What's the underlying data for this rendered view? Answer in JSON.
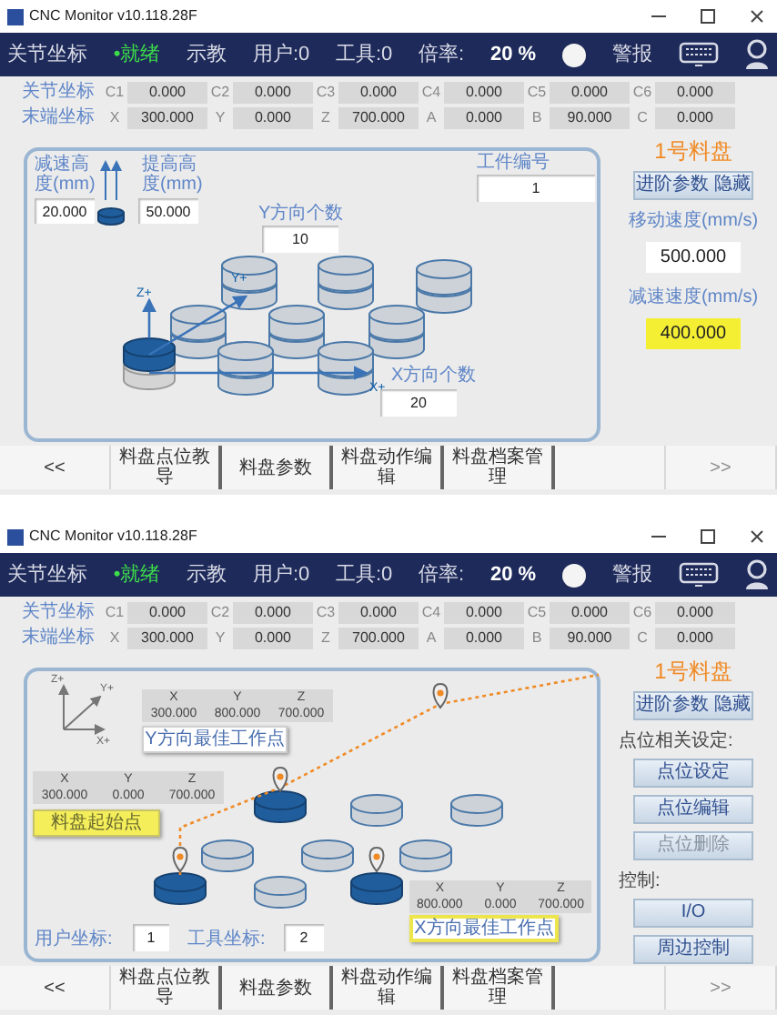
{
  "windows": [
    {
      "title_bar": {
        "title": "CNC Monitor v10.118.28F"
      },
      "status_bar": {
        "mode": "关节坐标",
        "state": {
          "text": "•就绪",
          "ok": true
        },
        "teach": "示教",
        "user": "用户:0",
        "tool": "工具:0",
        "rate_label": "倍率:",
        "rate": "20 %",
        "alarm": "警报"
      },
      "coordinates": [
        {
          "label": "关节坐标",
          "axes": [
            {
              "name": "C1",
              "value": "0.000"
            },
            {
              "name": "C2",
              "value": "0.000"
            },
            {
              "name": "C3",
              "value": "0.000"
            },
            {
              "name": "C4",
              "value": "0.000"
            },
            {
              "name": "C5",
              "value": "0.000"
            },
            {
              "name": "C6",
              "value": "0.000"
            }
          ]
        },
        {
          "label": "末端坐标",
          "axes": [
            {
              "name": "X",
              "value": "300.000"
            },
            {
              "name": "Y",
              "value": "0.000"
            },
            {
              "name": "Z",
              "value": "700.000"
            },
            {
              "name": "A",
              "value": "0.000"
            },
            {
              "name": "B",
              "value": "90.000"
            },
            {
              "name": "C",
              "value": "0.000"
            }
          ]
        }
      ],
      "panel": {
        "kind": "tray_params",
        "lower_height": {
          "label": "减速高度(mm)",
          "value": "20.000"
        },
        "lift_height": {
          "label": "提高高度(mm)",
          "value": "50.000"
        },
        "workpiece_no": {
          "label": "工件编号",
          "value": "1"
        },
        "y_count": {
          "label": "Y方向个数",
          "value": "10"
        },
        "x_count": {
          "label": "X方向个数",
          "value": "20"
        },
        "axis_labels": [
          "Z+",
          "Y+",
          "X+"
        ]
      },
      "side": [
        {
          "kind": "title",
          "text": "1号料盘"
        },
        {
          "kind": "button",
          "text": "进阶参数 隐藏",
          "disabled": false
        },
        {
          "kind": "label",
          "text": "移动速度(mm/s)"
        },
        {
          "kind": "field",
          "value": "500.000",
          "highlight": false
        },
        {
          "kind": "label",
          "text": "减速速度(mm/s)"
        },
        {
          "kind": "field",
          "value": "400.000",
          "highlight": true
        }
      ],
      "tabs": [
        {
          "label": "<<",
          "disabled": false
        },
        {
          "label": "料盘点位教导",
          "disabled": false
        },
        {
          "label": "料盘参数",
          "disabled": false
        },
        {
          "label": "料盘动作编辑",
          "disabled": false
        },
        {
          "label": "料盘档案管理",
          "disabled": false
        },
        {
          "label": ">>",
          "disabled": true
        }
      ]
    },
    {
      "title_bar": {
        "title": "CNC Monitor v10.118.28F"
      },
      "status_bar": {
        "mode": "关节坐标",
        "state": {
          "text": "•就绪",
          "ok": true
        },
        "teach": "示教",
        "user": "用户:0",
        "tool": "工具:0",
        "rate_label": "倍率:",
        "rate": "20 %",
        "alarm": "警报"
      },
      "coordinates": [
        {
          "label": "关节坐标",
          "axes": [
            {
              "name": "C1",
              "value": "0.000"
            },
            {
              "name": "C2",
              "value": "0.000"
            },
            {
              "name": "C3",
              "value": "0.000"
            },
            {
              "name": "C4",
              "value": "0.000"
            },
            {
              "name": "C5",
              "value": "0.000"
            },
            {
              "name": "C6",
              "value": "0.000"
            }
          ]
        },
        {
          "label": "末端坐标",
          "axes": [
            {
              "name": "X",
              "value": "300.000"
            },
            {
              "name": "Y",
              "value": "0.000"
            },
            {
              "name": "Z",
              "value": "700.000"
            },
            {
              "name": "A",
              "value": "0.000"
            },
            {
              "name": "B",
              "value": "90.000"
            },
            {
              "name": "C",
              "value": "0.000"
            }
          ]
        }
      ],
      "panel": {
        "kind": "point_teach",
        "axis_labels": [
          "Z+",
          "Y+",
          "X+"
        ],
        "points": [
          {
            "headers": [
              "X",
              "Y",
              "Z"
            ],
            "values": [
              "300.000",
              "800.000",
              "700.000"
            ],
            "button": "Y方向最佳工作点",
            "kind": "plain"
          },
          {
            "headers": [
              "X",
              "Y",
              "Z"
            ],
            "values": [
              "300.000",
              "0.000",
              "700.000"
            ],
            "button": "料盘起始点",
            "kind": "filled"
          },
          {
            "headers": [
              "X",
              "Y",
              "Z"
            ],
            "values": [
              "800.000",
              "0.000",
              "700.000"
            ],
            "button": "X方向最佳工作点",
            "kind": "outlined"
          }
        ],
        "user_coord": {
          "label": "用户坐标:",
          "value": "1"
        },
        "tool_coord": {
          "label": "工具坐标:",
          "value": "2"
        }
      },
      "side": [
        {
          "kind": "title",
          "text": "1号料盘"
        },
        {
          "kind": "button",
          "text": "进阶参数 隐藏",
          "disabled": false
        },
        {
          "kind": "heading",
          "text": "点位相关设定:"
        },
        {
          "kind": "button",
          "text": "点位设定",
          "disabled": false
        },
        {
          "kind": "button",
          "text": "点位编辑",
          "disabled": false
        },
        {
          "kind": "button",
          "text": "点位删除",
          "disabled": true
        },
        {
          "kind": "heading",
          "text": "控制:"
        },
        {
          "kind": "button",
          "text": "I/O",
          "disabled": false
        },
        {
          "kind": "button",
          "text": "周边控制",
          "disabled": false
        }
      ],
      "tabs": [
        {
          "label": "<<",
          "disabled": false
        },
        {
          "label": "料盘点位教导",
          "disabled": false
        },
        {
          "label": "料盘参数",
          "disabled": false
        },
        {
          "label": "料盘动作编辑",
          "disabled": false
        },
        {
          "label": "料盘档案管理",
          "disabled": false
        },
        {
          "label": ">>",
          "disabled": true
        }
      ]
    }
  ]
}
